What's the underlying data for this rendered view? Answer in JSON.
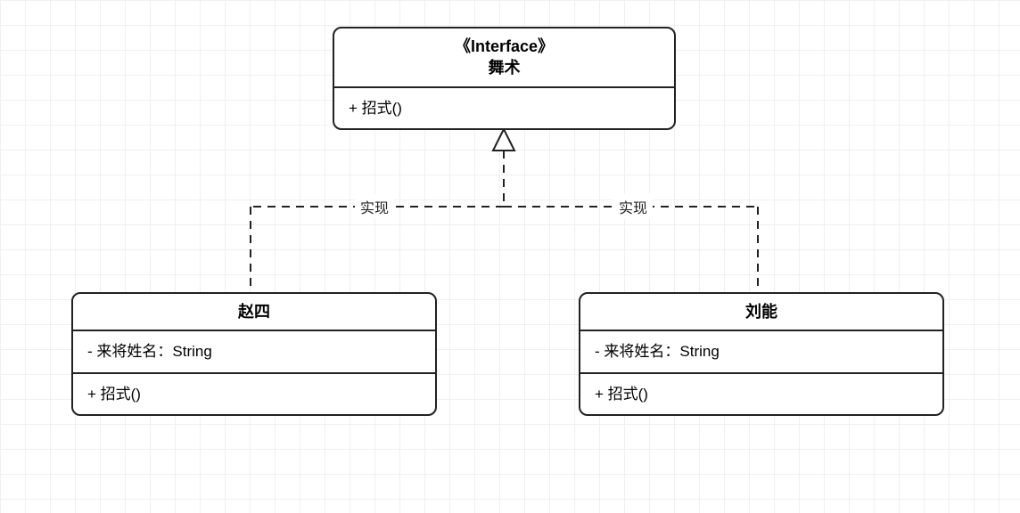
{
  "interface": {
    "stereotype": "《Interface》",
    "name": "舞术",
    "methods": [
      "+ 招式()"
    ]
  },
  "classes": [
    {
      "id": "zhaosi",
      "name": "赵四",
      "attributes": [
        "- 来将姓名：String"
      ],
      "methods": [
        "+ 招式()"
      ],
      "edge_label": "实现"
    },
    {
      "id": "liuneng",
      "name": "刘能",
      "attributes": [
        "- 来将姓名：String"
      ],
      "methods": [
        "+ 招式()"
      ],
      "edge_label": "实现"
    }
  ]
}
